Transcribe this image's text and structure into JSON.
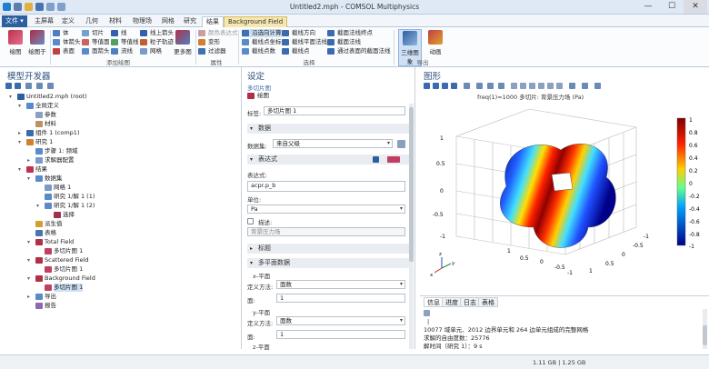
{
  "window": {
    "title": "Untitled2.mph - COMSOL Multiphysics",
    "minimize": "—",
    "maximize": "☐",
    "close": "✕"
  },
  "ribbon_tabs": [
    "文件 ▾",
    "主屏幕",
    "定义",
    "几何",
    "材料",
    "物理场",
    "网格",
    "研究",
    "结果",
    "Background Field"
  ],
  "ribbon": {
    "plot_button": "绘图",
    "plot_in_button": "绘图于",
    "vol_group": [
      "体",
      "体箭头",
      "表面"
    ],
    "slice_group": [
      "切片",
      "等值面",
      "面箭头"
    ],
    "line_group": [
      "线",
      "等值线",
      "流线"
    ],
    "line2_group": [
      "线上箭头",
      "粒子轨迹",
      "网格"
    ],
    "more_plots": "更多图",
    "add_group": "添加绘图",
    "attr_group": [
      "颜色表达式",
      "变形",
      "过滤器"
    ],
    "attr_label": "属性",
    "sel_group": [
      "设置选择",
      "截线点",
      "截线",
      "截线",
      "截线",
      "截线"
    ],
    "select_items": [
      "沿选向计算",
      "截线点坐标",
      "截线点数",
      "截线方向",
      "截线平面法线",
      "截线点",
      "截面法线终点",
      "截面法线",
      "通过表面的截面法线"
    ],
    "select_label": "选择",
    "export_buttons": [
      "三维图象",
      "动画"
    ],
    "export_label": "导出"
  },
  "left_panel": {
    "title": "模型开发器",
    "tree": [
      {
        "label": "Untitled2.mph (root)",
        "level": 0,
        "icon": "root-icon"
      },
      {
        "label": "全局定义",
        "level": 1,
        "icon": "globe-icon"
      },
      {
        "label": "参数",
        "level": 2,
        "icon": "pi-icon"
      },
      {
        "label": "材料",
        "level": 2,
        "icon": "material-icon"
      },
      {
        "label": "组件 1 (comp1)",
        "level": 1,
        "icon": "component-icon"
      },
      {
        "label": "研究 1",
        "level": 1,
        "icon": "study-icon"
      },
      {
        "label": "步骤 1: 频域",
        "level": 2,
        "icon": "step-icon"
      },
      {
        "label": "求解器配置",
        "level": 2,
        "icon": "solver-icon"
      },
      {
        "label": "结果",
        "level": 1,
        "icon": "results-icon"
      },
      {
        "label": "数据集",
        "level": 2,
        "icon": "dataset-icon"
      },
      {
        "label": "网格 1",
        "level": 3,
        "icon": "mesh-icon"
      },
      {
        "label": "研究 1/解 1 (1)",
        "level": 3,
        "icon": "solution-icon"
      },
      {
        "label": "研究 1/解 1 (2)",
        "level": 3,
        "icon": "solution-icon"
      },
      {
        "label": "选择",
        "level": 4,
        "icon": "selection-icon"
      },
      {
        "label": "派生值",
        "level": 2,
        "icon": "derived-icon"
      },
      {
        "label": "表格",
        "level": 2,
        "icon": "table-icon"
      },
      {
        "label": "Total Field",
        "level": 2,
        "icon": "plotgroup-icon"
      },
      {
        "label": "多切片图 1",
        "level": 3,
        "icon": "multislice-icon"
      },
      {
        "label": "Scattered Field",
        "level": 2,
        "icon": "plotgroup-icon"
      },
      {
        "label": "多切片图 1",
        "level": 3,
        "icon": "multislice-icon"
      },
      {
        "label": "Background Field",
        "level": 2,
        "icon": "plotgroup-icon"
      },
      {
        "label": "多切片图 1",
        "level": 3,
        "icon": "multislice-icon"
      },
      {
        "label": "导出",
        "level": 2,
        "icon": "export-icon"
      },
      {
        "label": "报告",
        "level": 2,
        "icon": "report-icon"
      }
    ]
  },
  "settings": {
    "title": "设定",
    "subtitle": "多切片图",
    "plot_button": "绘图",
    "label_label": "标签:",
    "label_value": "多切片图 1",
    "data_section": "数据",
    "dataset_label": "数据集:",
    "dataset_value": "来自父级",
    "expr_section": "表达式",
    "expression_label": "表达式:",
    "expression_value": "acpr.p_b",
    "unit_label": "单位:",
    "unit_value": "Pa",
    "description_label": "描述:",
    "description_value": "背景压力场",
    "title_section": "标题",
    "multiplane_section": "多平面数据",
    "x_plane": "x-平面",
    "define_method_label": "定义方法:",
    "define_method_value": "面数",
    "planes_label": "面:",
    "planes_value": "1",
    "y_plane": "y-平面",
    "z_plane": "z-平面"
  },
  "graphics": {
    "title": "图形",
    "plot_title": "freq(1)=1000   多切片: 背景压力场 (Pa)",
    "colorbar_ticks": [
      "1",
      "0.8",
      "0.6",
      "0.4",
      "0.2",
      "0",
      "-0.2",
      "-0.4",
      "-0.6",
      "-0.8",
      "-1"
    ],
    "axis_ticks": [
      "1",
      "0.5",
      "0",
      "-0.5",
      "-1"
    ],
    "axis_labels": [
      "y",
      "z",
      "x"
    ]
  },
  "messages": {
    "tabs": [
      "信息",
      "进度",
      "日志",
      "表格"
    ],
    "lines": [
      "10077 域单元、2012 边界单元和 264 边单元组成的完整网格",
      "求解的自由度数：25776",
      "解时间（研究 1）：9 s"
    ],
    "cursor": "|"
  },
  "status": {
    "memory": "1.11 GB | 1.25 GB"
  },
  "colors": {
    "accent": "#2d5f9e",
    "context_tab": "#f6e7b0"
  }
}
